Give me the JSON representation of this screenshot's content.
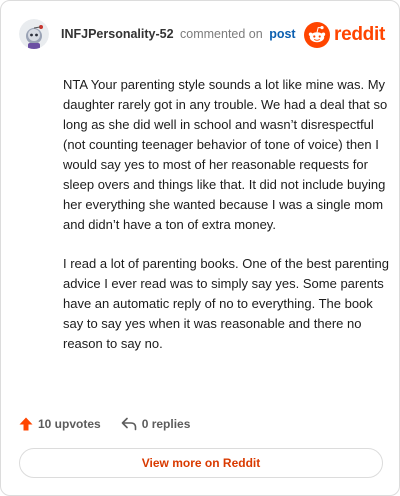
{
  "header": {
    "username": "INFJPersonality-52",
    "action_text": "commented on",
    "post_link": "post",
    "brand_name": "reddit"
  },
  "comment": {
    "paragraphs": [
      "NTA Your parenting style sounds a lot like mine was. My daughter rarely got in any trouble. We had a deal that so long as she did well in school and wasn’t disrespectful (not counting teenager behavior of tone of voice) then I would say yes to most of her reasonable requests for sleep overs and things like that. It did not include buying her everything she wanted because I was a single mom and didn’t have a ton of extra money.",
      "I read a lot of parenting books. One of the best parenting advice I ever read was to simply say yes. Some parents have an automatic reply of no to everything. The book say to say yes when it was reasonable and there no reason to say no."
    ]
  },
  "actions": {
    "upvotes": "10 upvotes",
    "replies": "0 replies"
  },
  "footer": {
    "view_more": "View more on Reddit"
  },
  "colors": {
    "brand": "#ff4500",
    "link": "#0b5fb0",
    "view_more": "#d93a00",
    "upvote_arrow": "#ff4500"
  },
  "icons": {
    "avatar": "snoo-avatar",
    "brand": "reddit-logo-icon",
    "upvote": "upvote-arrow-icon",
    "reply": "reply-arrow-icon"
  }
}
